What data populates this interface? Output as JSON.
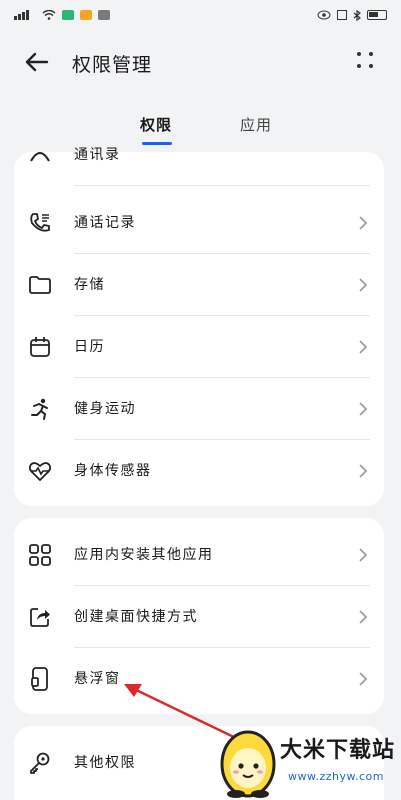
{
  "status_bar": {
    "left_icons": [
      "signal-icon",
      "wifi-icon",
      "app-icons"
    ],
    "right_icons": [
      "eye-icon",
      "nfc-icon",
      "bluetooth-icon",
      "battery-icon"
    ]
  },
  "header": {
    "title": "权限管理"
  },
  "tabs": [
    {
      "label": "权限",
      "active": true
    },
    {
      "label": "应用",
      "active": false
    }
  ],
  "card1": {
    "items": [
      {
        "label": "通讯录",
        "icon": "contacts-icon"
      },
      {
        "label": "通话记录",
        "icon": "call-log-icon"
      },
      {
        "label": "存储",
        "icon": "folder-icon"
      },
      {
        "label": "日历",
        "icon": "calendar-icon"
      },
      {
        "label": "健身运动",
        "icon": "running-icon"
      },
      {
        "label": "身体传感器",
        "icon": "heart-rate-icon"
      }
    ]
  },
  "card2": {
    "items": [
      {
        "label": "应用内安装其他应用",
        "icon": "apps-icon"
      },
      {
        "label": "创建桌面快捷方式",
        "icon": "shortcut-icon"
      },
      {
        "label": "悬浮窗",
        "icon": "floating-window-icon"
      }
    ]
  },
  "card3": {
    "items": [
      {
        "label": "其他权限",
        "icon": "key-icon"
      }
    ]
  },
  "watermark": {
    "title": "大米下载站",
    "url": "www.zzhyw.com"
  },
  "colors": {
    "accent": "#1e5eff",
    "arrow": "#d92b2b"
  }
}
